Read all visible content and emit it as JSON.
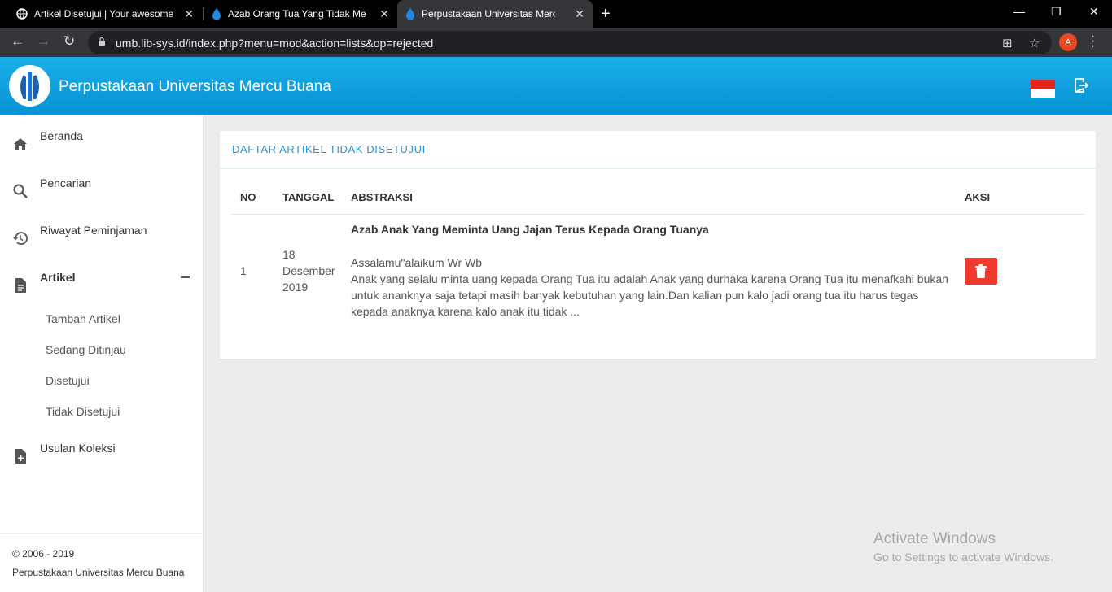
{
  "browser": {
    "tabs": [
      {
        "title": "Artikel Disetujui | Your awesome Lib"
      },
      {
        "title": "Azab Orang Tua Yang Tidak Menafkah"
      },
      {
        "title": "Perpustakaan Universitas Mercu Buana"
      }
    ],
    "url": "umb.lib-sys.id/index.php?menu=mod&action=lists&op=rejected",
    "profile_initial": "A"
  },
  "app": {
    "title": "Perpustakaan Universitas Mercu Buana"
  },
  "sidebar": {
    "items": [
      {
        "label": "Beranda",
        "icon": "home-icon"
      },
      {
        "label": "Pencarian",
        "icon": "search-icon"
      },
      {
        "label": "Riwayat Peminjaman",
        "icon": "history-icon"
      },
      {
        "label": "Artikel",
        "icon": "document-icon"
      },
      {
        "label": "Usulan Koleksi",
        "icon": "file-add-icon"
      }
    ],
    "artikel_sub": [
      "Tambah Artikel",
      "Sedang Ditinjau",
      "Disetujui",
      "Tidak Disetujui"
    ],
    "footer_copyright": "© 2006 - 2019",
    "footer_name": "Perpustakaan Universitas Mercu Buana"
  },
  "main": {
    "card_title": "DAFTAR ARTIKEL TIDAK DISETUJUI",
    "columns": [
      "NO",
      "TANGGAL",
      "ABSTRAKSI",
      "AKSI"
    ],
    "rows": [
      {
        "no": "1",
        "date_day": "18",
        "date_month": "Desember",
        "date_year": "2019",
        "title": "Azab Anak Yang Meminta Uang Jajan Terus Kepada Orang Tuanya",
        "greeting": "Assalamu\"alaikum Wr Wb",
        "abstract": "Anak yang selalu minta uang kepada Orang Tua itu adalah Anak yang durhaka karena Orang Tua itu menafkahi bukan untuk ananknya saja tetapi masih banyak kebutuhan yang lain.Dan kalian pun kalo jadi orang tua itu harus tegas kepada anaknya karena kalo anak itu tidak ..."
      }
    ]
  },
  "watermark": {
    "line1": "Activate Windows",
    "line2": "Go to Settings to activate Windows."
  },
  "colors": {
    "header": "#0a9ddf",
    "accent": "#2a93d5",
    "delete": "#ee3b2e"
  }
}
